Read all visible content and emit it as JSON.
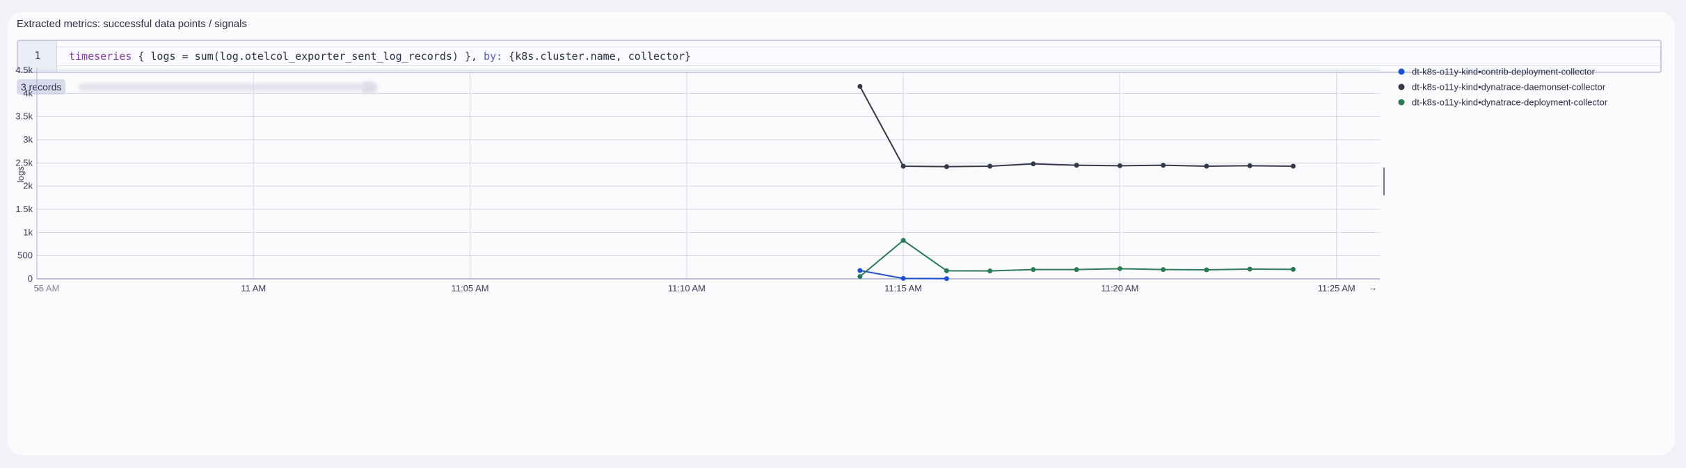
{
  "card": {
    "title": "Extracted metrics: successful data points / signals"
  },
  "editor": {
    "line_number": "1",
    "code": {
      "keyword": "timeseries",
      "part1": " { logs = sum(log.otelcol_exporter_sent_log_records) }, ",
      "by_keyword": "by:",
      "part2": " {k8s.cluster.name, collector}"
    }
  },
  "records_badge": "3 records",
  "colors": {
    "contrib": "#1f4fd0",
    "daemonset": "#353849",
    "deployment": "#2a7a55",
    "grid": "#d2d5e6"
  },
  "chart_data": {
    "type": "line",
    "title": "",
    "xlabel": "",
    "ylabel": "logs",
    "ylim": [
      0,
      4500
    ],
    "y_ticks": [
      0,
      500,
      1000,
      1500,
      2000,
      2500,
      3000,
      3500,
      4000,
      4500
    ],
    "y_tick_labels": [
      "0",
      "500",
      "1k",
      "1.5k",
      "2k",
      "2.5k",
      "3k",
      "3.5k",
      "4k",
      "4.5k"
    ],
    "x_unit": "minutes",
    "xlim": [
      "10:55",
      "11:26"
    ],
    "x_ticks": [
      "10:55",
      "11:00",
      "11:05",
      "11:10",
      "11:15",
      "11:20",
      "11:25"
    ],
    "x_tick_labels": [
      "55 AM",
      "11 AM",
      "11:05 AM",
      "11:10 AM",
      "11:15 AM",
      "11:20 AM",
      "11:25 AM"
    ],
    "grid": true,
    "legend_position": "top-right",
    "series": [
      {
        "name": "dt-k8s-o11y-kind•contrib-deployment-collector",
        "color": "#1f4fd0",
        "x": [
          "11:14",
          "11:15",
          "11:16"
        ],
        "values": [
          180,
          10,
          5
        ]
      },
      {
        "name": "dt-k8s-o11y-kind•dynatrace-daemonset-collector",
        "color": "#353849",
        "x": [
          "11:14",
          "11:15",
          "11:16",
          "11:17",
          "11:18",
          "11:19",
          "11:20",
          "11:21",
          "11:22",
          "11:23",
          "11:24"
        ],
        "values": [
          4150,
          2430,
          2420,
          2430,
          2480,
          2450,
          2440,
          2450,
          2430,
          2440,
          2430
        ]
      },
      {
        "name": "dt-k8s-o11y-kind•dynatrace-deployment-collector",
        "color": "#2a7a55",
        "x": [
          "11:14",
          "11:15",
          "11:16",
          "11:17",
          "11:18",
          "11:19",
          "11:20",
          "11:21",
          "11:22",
          "11:23",
          "11:24"
        ],
        "values": [
          50,
          830,
          175,
          170,
          200,
          200,
          220,
          200,
          195,
          210,
          205
        ]
      }
    ]
  }
}
